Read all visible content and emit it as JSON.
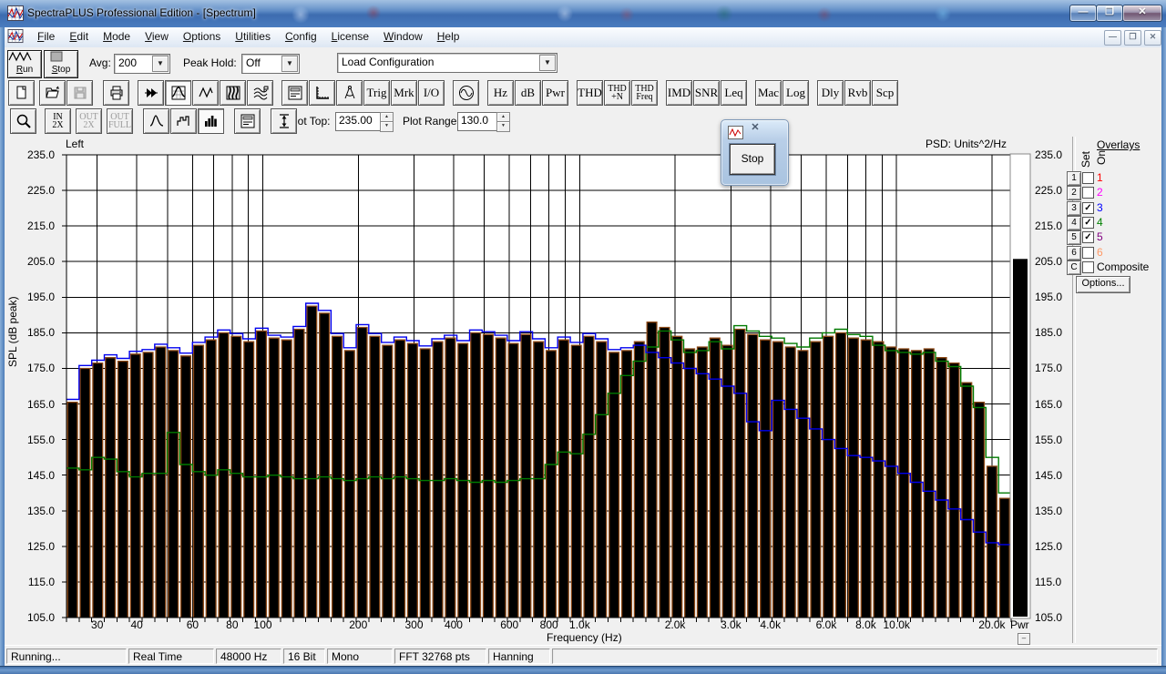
{
  "window": {
    "title": "SpectraPLUS Professional Edition - [Spectrum]",
    "controls": {
      "minimize": "—",
      "maximize": "❐",
      "close": "✕"
    }
  },
  "menu": {
    "items": [
      "File",
      "Edit",
      "Mode",
      "View",
      "Options",
      "Utilities",
      "Config",
      "License",
      "Window",
      "Help"
    ],
    "mdi_controls": {
      "minimize": "—",
      "restore": "❐",
      "close": "✕"
    }
  },
  "transport": {
    "run_label": "Run",
    "stop_label": "Stop",
    "avg_label": "Avg:",
    "avg_value": "200",
    "peak_hold_label": "Peak Hold:",
    "peak_hold_value": "Off",
    "load_config_value": "Load Configuration"
  },
  "toolbar_buttons": {
    "trig": "Trig",
    "mrk": "Mrk",
    "io": "I/O",
    "hz": "Hz",
    "db": "dB",
    "pwr": "Pwr",
    "thd": "THD",
    "thd_n": "THD\n+N",
    "thd_freq": "THD\nFreq",
    "imd": "IMD",
    "snr": "SNR",
    "leq": "Leq",
    "mac": "Mac",
    "log": "Log",
    "dly": "Dly",
    "rvb": "Rvb",
    "scp": "Scp",
    "zoom_in_2x": "IN\n2X",
    "zoom_out_2x": "OUT\n2X",
    "zoom_out_full": "OUT\nFULL"
  },
  "plot_controls": {
    "plot_top_label": "Plot Top:",
    "plot_top_value": "235.00",
    "plot_range_label": "Plot Range:",
    "plot_range_value": "130.0"
  },
  "stop_palette": {
    "stop_label": "Stop",
    "close_glyph": "✕"
  },
  "plot": {
    "channel_label": "Left",
    "units_label": "PSD: Units^2/Hz",
    "ylabel": "SPL (dB peak)",
    "xlabel": "Frequency (Hz)",
    "pwr_label": "Pwr",
    "pwr_min_glyph": "–"
  },
  "overlays": {
    "title": "Overlays",
    "set_label": "Set",
    "on_label": "On",
    "options_label": "Options...",
    "rows": [
      {
        "btn": "1",
        "label": "1",
        "color": "#ff0000",
        "checked": false
      },
      {
        "btn": "2",
        "label": "2",
        "color": "#ff00ff",
        "checked": false
      },
      {
        "btn": "3",
        "label": "3",
        "color": "#0000ff",
        "checked": true
      },
      {
        "btn": "4",
        "label": "4",
        "color": "#008000",
        "checked": true
      },
      {
        "btn": "5",
        "label": "5",
        "color": "#800080",
        "checked": true
      },
      {
        "btn": "6",
        "label": "6",
        "color": "#ff9966",
        "checked": false
      },
      {
        "btn": "C",
        "label": "Composite",
        "color": "#000000",
        "checked": false
      }
    ]
  },
  "status_bar": {
    "items": [
      "Running...",
      "Real Time",
      "48000 Hz",
      "16 Bit",
      "Mono",
      "FFT 32768 pts",
      "Hanning"
    ]
  },
  "chart_data": {
    "type": "bar",
    "title": "Spectrum",
    "xlabel": "Frequency (Hz)",
    "ylabel": "SPL (dB peak)",
    "x_scale": "log",
    "x_range_hz": [
      24,
      23000
    ],
    "y_range_db": [
      105,
      235
    ],
    "grid": true,
    "bar_color": "#000000",
    "bar_outline_color": "#8e4a17",
    "y_ticks": [
      "235.0",
      "225.0",
      "215.0",
      "205.0",
      "195.0",
      "185.0",
      "175.0",
      "165.0",
      "155.0",
      "145.0",
      "135.0",
      "125.0",
      "115.0",
      "105.0"
    ],
    "x_ticks": [
      {
        "hz": 30,
        "label": "30"
      },
      {
        "hz": 40,
        "label": "40"
      },
      {
        "hz": 60,
        "label": "60"
      },
      {
        "hz": 80,
        "label": "80"
      },
      {
        "hz": 100,
        "label": "100"
      },
      {
        "hz": 200,
        "label": "200"
      },
      {
        "hz": 300,
        "label": "300"
      },
      {
        "hz": 400,
        "label": "400"
      },
      {
        "hz": 600,
        "label": "600"
      },
      {
        "hz": 800,
        "label": "800"
      },
      {
        "hz": 1000,
        "label": "1.0k"
      },
      {
        "hz": 2000,
        "label": "2.0k"
      },
      {
        "hz": 3000,
        "label": "3.0k"
      },
      {
        "hz": 4000,
        "label": "4.0k"
      },
      {
        "hz": 6000,
        "label": "6.0k"
      },
      {
        "hz": 8000,
        "label": "8.0k"
      },
      {
        "hz": 10000,
        "label": "10.0k"
      },
      {
        "hz": 20000,
        "label": "20.0k"
      }
    ],
    "grid_hz": [
      30,
      40,
      50,
      60,
      70,
      80,
      90,
      100,
      200,
      300,
      400,
      500,
      600,
      700,
      800,
      900,
      1000,
      2000,
      3000,
      4000,
      5000,
      6000,
      7000,
      8000,
      9000,
      10000,
      20000
    ],
    "series": [
      {
        "name": "spectrum_bars_db",
        "style": "bar",
        "color": "#000000",
        "values": [
          165.5,
          175.0,
          176.5,
          178.0,
          177.0,
          179.0,
          179.5,
          181.0,
          180.0,
          178.5,
          181.5,
          183.0,
          185.0,
          184.0,
          182.5,
          185.5,
          183.5,
          183.0,
          186.0,
          192.5,
          190.5,
          184.0,
          180.0,
          186.5,
          184.0,
          181.5,
          183.0,
          182.0,
          180.5,
          182.5,
          183.5,
          182.0,
          185.0,
          184.5,
          183.5,
          182.0,
          184.5,
          182.5,
          180.0,
          183.0,
          181.5,
          184.0,
          182.5,
          179.5,
          180.0,
          182.5,
          188.0,
          186.5,
          184.0,
          180.5,
          181.0,
          183.5,
          181.5,
          186.0,
          184.5,
          183.0,
          182.5,
          181.0,
          180.0,
          182.5,
          184.0,
          185.0,
          183.5,
          183.0,
          182.5,
          181.0,
          180.5,
          180.0,
          180.5,
          178.0,
          176.5,
          171.0,
          165.5,
          147.5,
          138.5
        ]
      },
      {
        "name": "overlay_3_blue_db",
        "style": "step-line",
        "color": "#0000ee",
        "values": [
          166.3,
          175.8,
          177.3,
          178.8,
          177.8,
          179.8,
          180.3,
          181.8,
          180.8,
          179.3,
          182.3,
          183.8,
          185.8,
          184.8,
          183.3,
          186.3,
          184.3,
          183.8,
          186.8,
          193.3,
          191.3,
          184.8,
          180.8,
          187.3,
          184.8,
          182.3,
          183.8,
          182.8,
          181.3,
          183.3,
          184.3,
          182.8,
          185.8,
          185.3,
          184.3,
          182.8,
          185.3,
          183.3,
          180.8,
          183.8,
          182.3,
          184.8,
          183.3,
          180.3,
          180.8,
          181.5,
          179.5,
          178.0,
          176.5,
          175.0,
          173.5,
          172.0,
          170.0,
          168.0,
          160.0,
          157.5,
          166.0,
          163.5,
          161.0,
          158.0,
          155.0,
          152.5,
          150.5,
          150.0,
          149.0,
          147.5,
          145.5,
          143.0,
          140.5,
          138.0,
          135.5,
          132.5,
          129.0,
          126.0,
          125.5
        ]
      },
      {
        "name": "overlay_4_green_db",
        "style": "step-line",
        "color": "#007a00",
        "values": [
          147.0,
          146.5,
          150.0,
          149.5,
          146.0,
          144.5,
          145.5,
          145.5,
          157.0,
          148.0,
          146.0,
          145.0,
          146.5,
          145.5,
          144.5,
          144.5,
          145.0,
          144.5,
          144.0,
          144.0,
          144.5,
          144.0,
          143.5,
          144.0,
          144.5,
          144.0,
          144.5,
          144.0,
          143.5,
          143.5,
          144.0,
          143.5,
          143.0,
          143.5,
          143.0,
          143.5,
          144.0,
          144.0,
          148.0,
          151.5,
          151.0,
          156.5,
          162.0,
          168.0,
          173.0,
          177.0,
          181.0,
          185.5,
          183.0,
          179.5,
          180.0,
          182.5,
          180.5,
          187.0,
          185.5,
          184.0,
          183.5,
          182.0,
          181.0,
          183.5,
          185.0,
          186.0,
          184.5,
          184.0,
          181.5,
          180.0,
          179.5,
          179.0,
          179.5,
          177.0,
          175.5,
          170.0,
          164.0,
          150.0,
          140.0
        ]
      }
    ],
    "pwr_meter": {
      "label": "Pwr",
      "value_db": 205.5,
      "min_db": 105,
      "max_db": 235
    }
  }
}
